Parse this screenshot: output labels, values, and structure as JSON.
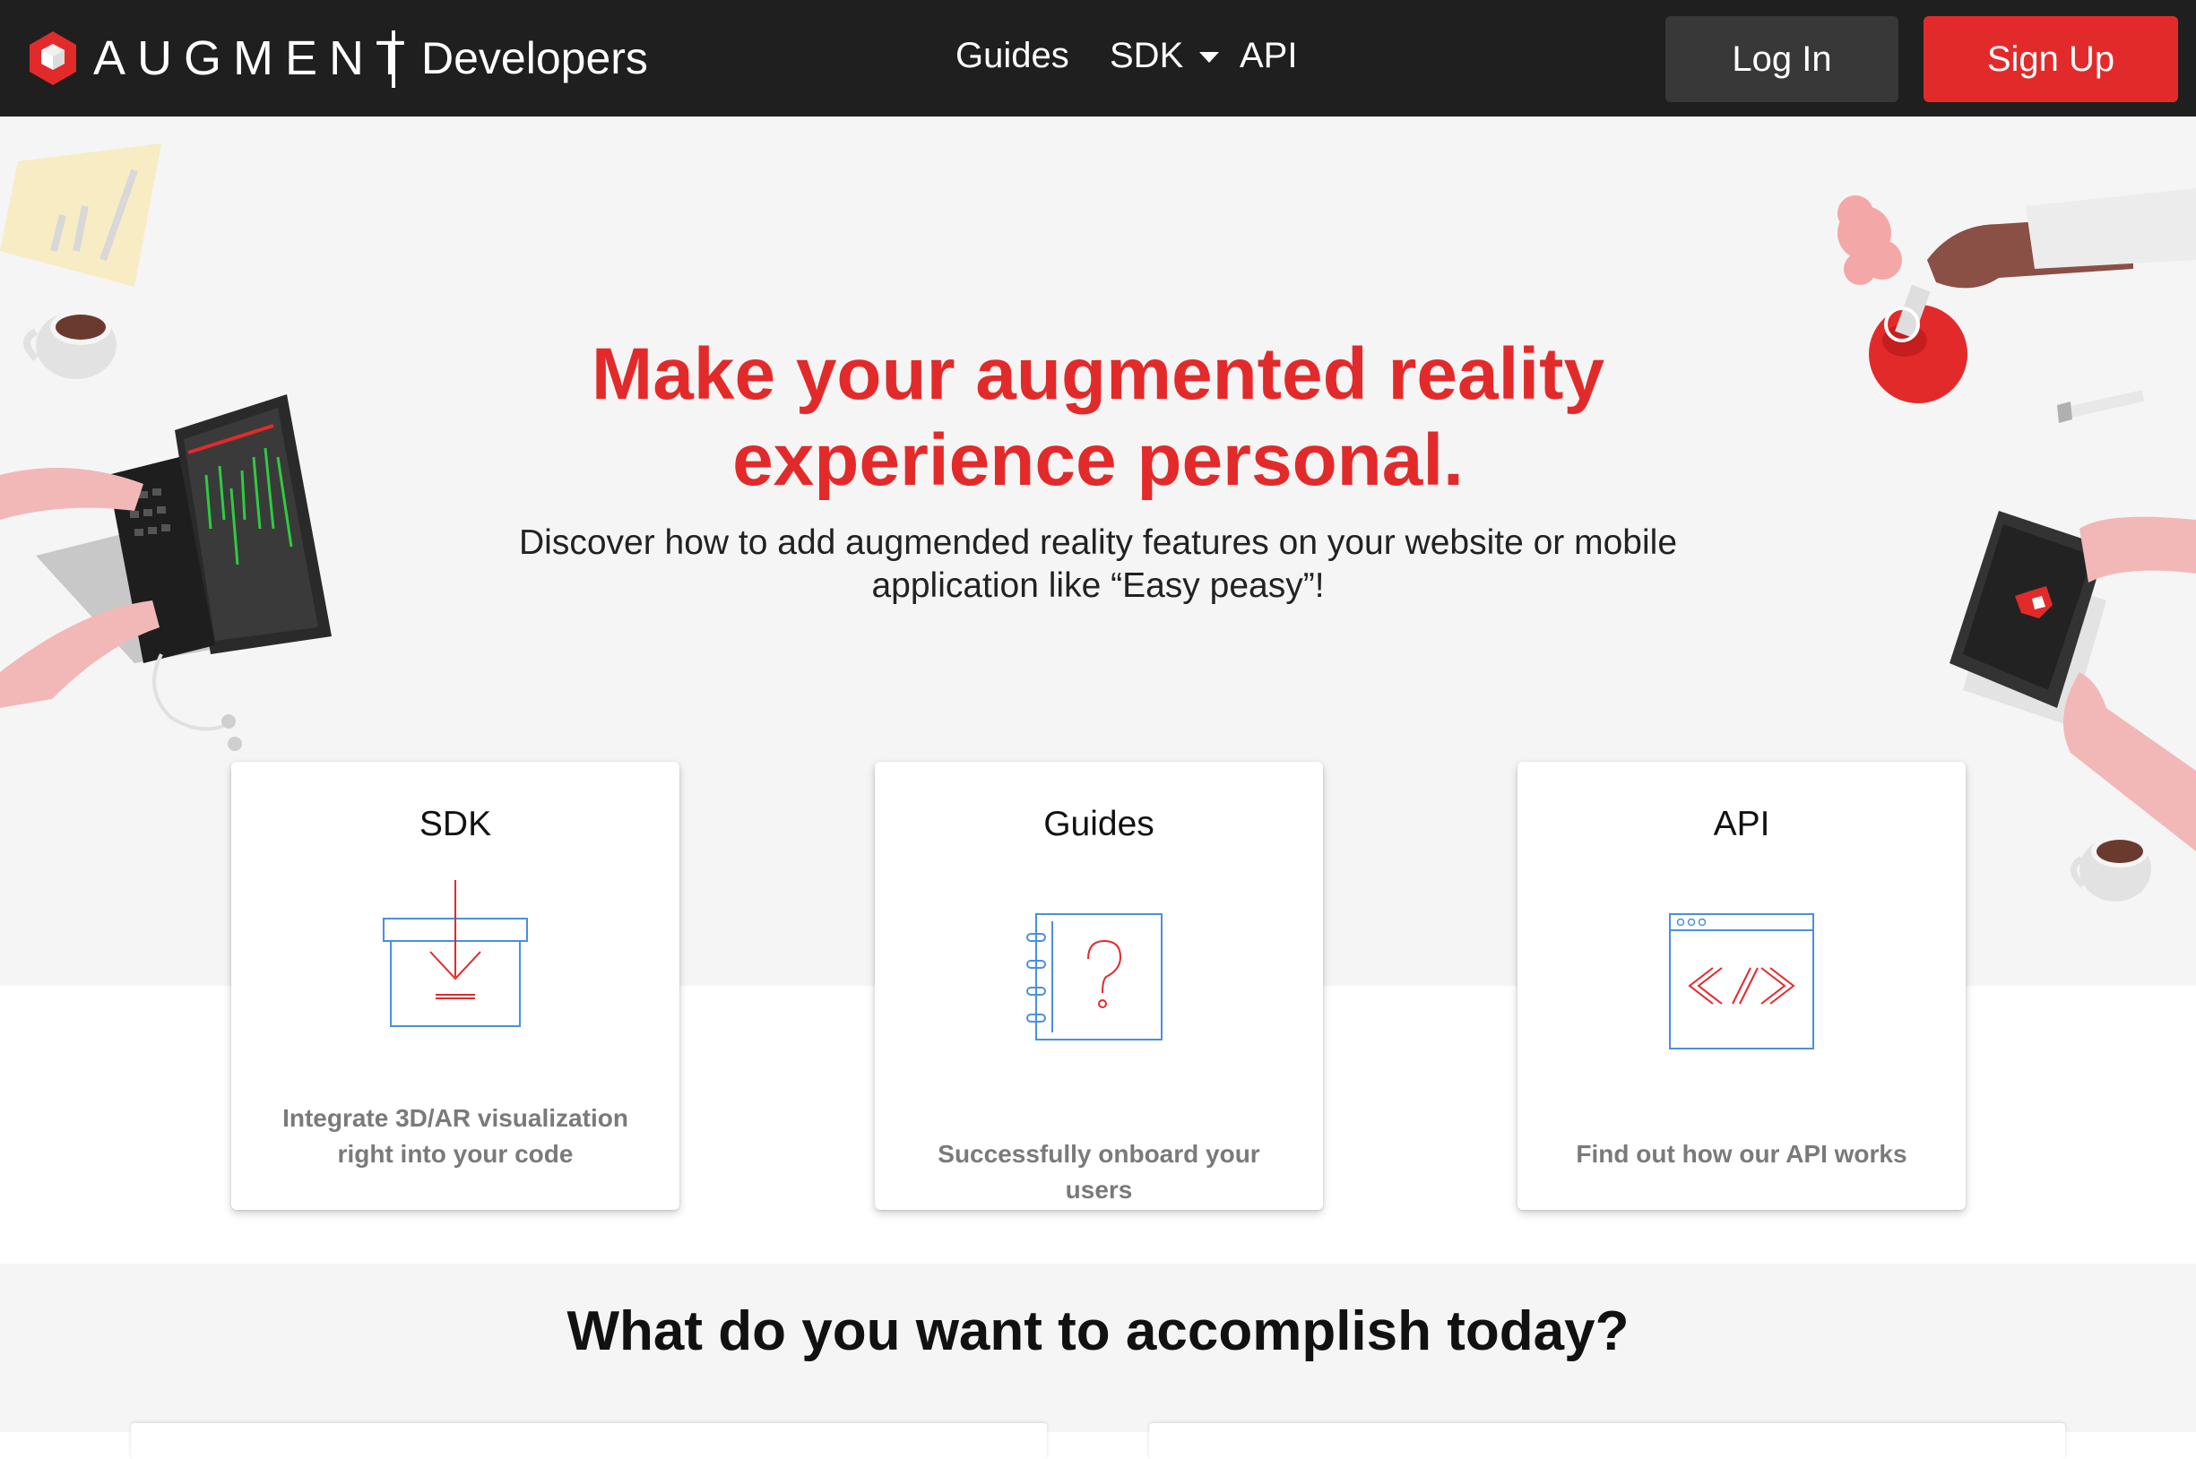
{
  "nav": {
    "brand_name": "AUGMENT",
    "brand_sub": "Developers",
    "links": [
      {
        "label": "Guides"
      },
      {
        "label": "SDK"
      },
      {
        "label": "API"
      }
    ],
    "login_label": "Log In",
    "signup_label": "Sign Up"
  },
  "hero": {
    "title_line1": "Make your augmented reality",
    "title_line2": "experience personal.",
    "subtitle_line1": "Discover how to add augmended reality features on your website or mobile",
    "subtitle_line2": "application like “Easy peasy”!"
  },
  "cards": [
    {
      "title": "SDK",
      "desc_line1": "Integrate 3D/AR visualization",
      "desc_line2": "right into your code",
      "icon": "download-box-icon"
    },
    {
      "title": "Guides",
      "desc_line1": "Successfully onboard your users",
      "icon": "question-notebook-icon"
    },
    {
      "title": "API",
      "desc_line1": "Find out how our API works",
      "icon": "code-window-icon"
    }
  ],
  "section": {
    "title": "What do you want to accomplish today?"
  },
  "colors": {
    "accent": "#e32a2a",
    "nav_bg": "#1f1f1f",
    "hero_bg": "#f5f5f5",
    "icon_blue": "#4a8fe0"
  }
}
